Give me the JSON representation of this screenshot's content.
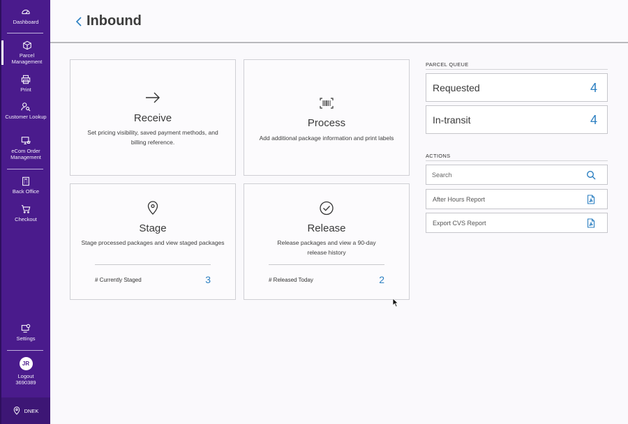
{
  "sidebar": {
    "items": [
      {
        "label": "Dashboard",
        "icon": "dashboard-gauge-icon"
      },
      {
        "label": "Parcel Management",
        "icon": "package-box-icon"
      },
      {
        "label": "Print",
        "icon": "printer-icon"
      },
      {
        "label": "Customer Lookup",
        "icon": "person-search-icon"
      },
      {
        "label": "eCom Order Management",
        "icon": "monitor-cart-icon"
      },
      {
        "label": "Back Office",
        "icon": "document-calculator-icon"
      },
      {
        "label": "Checkout",
        "icon": "shopping-cart-icon"
      },
      {
        "label": "Settings",
        "icon": "settings-monitor-gear-icon"
      }
    ],
    "user": {
      "initials": "JR",
      "logout_label": "Logout",
      "user_id": "3690389"
    },
    "location": {
      "code": "DNEK",
      "icon": "location-pin-icon"
    }
  },
  "header": {
    "title": "Inbound",
    "back_icon": "chevron-left-icon"
  },
  "cards": {
    "receive": {
      "title": "Receive",
      "description": "Set pricing visibility, saved payment methods, and billing reference.",
      "icon": "arrow-right-icon"
    },
    "process": {
      "title": "Process",
      "description": "Add additional package information and print labels",
      "icon": "barcode-scan-icon"
    },
    "stage": {
      "title": "Stage",
      "description": "Stage processed packages and view staged packages",
      "icon": "location-pin-icon",
      "stat_label": "# Currently Staged",
      "stat_value": "3"
    },
    "release": {
      "title": "Release",
      "description": "Release packages and view a 90-day release history",
      "icon": "check-circle-icon",
      "stat_label": "# Released Today",
      "stat_value": "2"
    }
  },
  "parcel_queue": {
    "heading": "PARCEL QUEUE",
    "items": [
      {
        "label": "Requested",
        "count": "4"
      },
      {
        "label": "In-transit",
        "count": "4"
      }
    ]
  },
  "actions": {
    "heading": "ACTIONS",
    "search_placeholder": "Search",
    "items": [
      {
        "label": "After Hours Report",
        "icon": "pdf-file-icon"
      },
      {
        "label": "Export CVS Report",
        "icon": "pdf-file-icon"
      }
    ]
  },
  "colors": {
    "sidebar": "#4a1b8c",
    "accent": "#2b7fc1",
    "background": "#faf9fc"
  }
}
